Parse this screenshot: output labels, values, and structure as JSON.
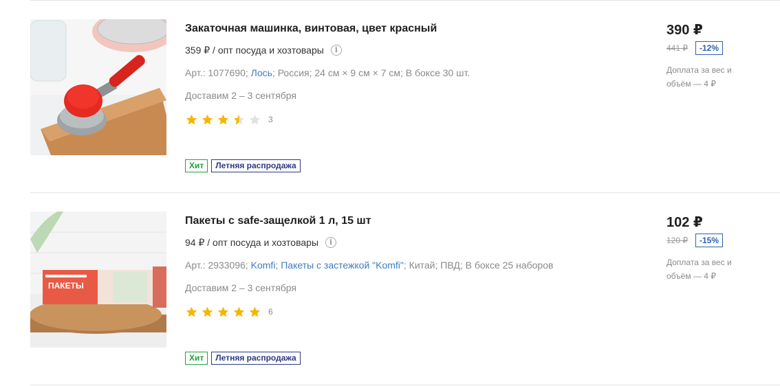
{
  "products": [
    {
      "title": "Закаточная машинка, винтовая, цвет красный",
      "wholesale": "359 ₽ / опт посуда и хозтовары",
      "specs": {
        "article": "Арт.: 1077690;",
        "brand": "Лось",
        "rest": "; Россия; 24 см × 9 см × 7 см; В боксе 30 шт."
      },
      "delivery": "Доставим 2 – 3 сентября",
      "rating": 3.5,
      "review_count": "3",
      "badges": {
        "hit": "Хит",
        "sale": "Летняя распродажа"
      },
      "price": "390 ₽",
      "old_price": "441 ₽",
      "discount": "-12%",
      "surcharge": "Доплата за вес и объём — 4 ₽",
      "image": "can-sealer-photo"
    },
    {
      "title": "Пакеты с safe-защелкой 1 л, 15 шт",
      "wholesale": "94 ₽ / опт посуда и хозтовары",
      "specs": {
        "article": "Арт.: 2933096;",
        "brand": "Komfi",
        "sep": ";",
        "series": "Пакеты с застежкой \"Komfi\"",
        "rest": "; Китай; ПВД; В боксе 25 наборов"
      },
      "delivery": "Доставим 2 – 3 сентября",
      "rating": 5,
      "review_count": "6",
      "badges": {
        "hit": "Хит",
        "sale": "Летняя распродажа"
      },
      "price": "102 ₽",
      "old_price": "120 ₽",
      "discount": "-15%",
      "surcharge": "Доплата за вес и объём — 4 ₽",
      "image": "zip-bags-photo",
      "image_label": "ПАКЕТЫ"
    }
  ],
  "colors": {
    "star_filled": "#f7b500",
    "star_empty": "#e2e2e2",
    "link": "#3f7bbf",
    "hit": "#1fa23d",
    "sale": "#2d3a7f",
    "discount": "#2d5fb3"
  }
}
